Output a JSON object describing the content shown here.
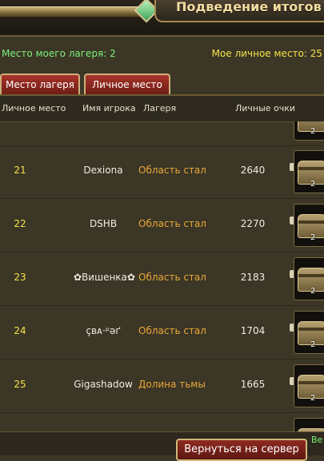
{
  "window": {
    "title": "Подведение итогов"
  },
  "info": {
    "camp_place": "Место моего лагеря: 2",
    "personal_place": "Мое личное место: 25"
  },
  "tabs": [
    {
      "label": "Место лагеря"
    },
    {
      "label": "Личное место"
    }
  ],
  "table": {
    "headers": {
      "rank": "Личное место",
      "name": "Имя игрока",
      "camp": "Лагеря",
      "points": "Личные очки"
    },
    "partial_row_reward_count": "2",
    "rows": [
      {
        "rank": "21",
        "name": "Dexiona",
        "camp": "Область стал",
        "points": "2640",
        "reward_count": "2"
      },
      {
        "rank": "22",
        "name": "DSHB",
        "camp": "Область стал",
        "points": "2270",
        "reward_count": "2"
      },
      {
        "rank": "23",
        "name": "✿Вишенка✿",
        "camp": "Область стал",
        "points": "2183",
        "reward_count": "2"
      },
      {
        "rank": "24",
        "name": "çʙᴀ·ᵖəґ",
        "camp": "Область стал",
        "points": "1704",
        "reward_count": "2"
      },
      {
        "rank": "25",
        "name": "Gigashadow",
        "camp": "Долина тьмы",
        "points": "1665",
        "reward_count": "2"
      }
    ]
  },
  "footer": {
    "return_button": "Вернуться на сервер",
    "note": "Ве на"
  },
  "colors": {
    "green_text": "#7cf07a",
    "yellow_text": "#f5e34a",
    "orange_text": "#e9a838",
    "tab_red": "#a8352a"
  }
}
